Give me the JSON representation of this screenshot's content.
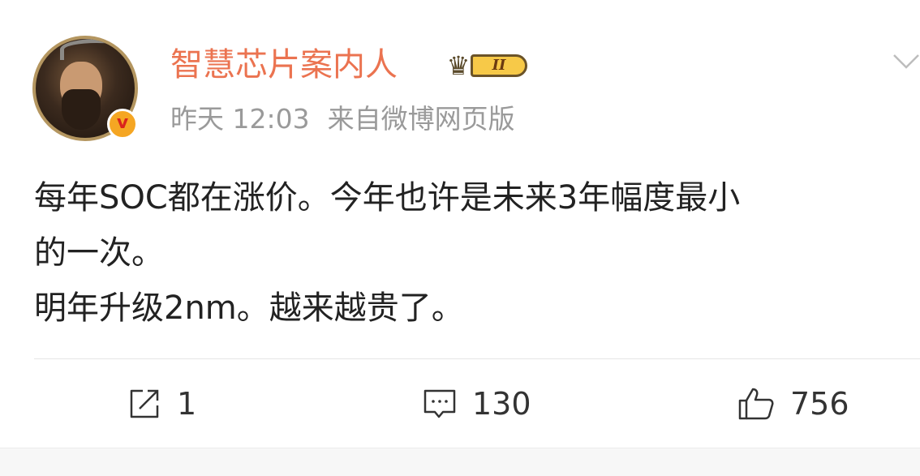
{
  "post": {
    "author": {
      "name": "智慧芯片案内人",
      "verified_badge": "v",
      "vip_level": "II",
      "avatar_icon": "portrait-avatar"
    },
    "meta": {
      "time": "昨天 12:03",
      "source": "来自微博网页版"
    },
    "content": {
      "lines": [
        "每年SOC都在涨价。今年也许是未来3年幅度最小",
        "的一次。",
        "明年升级2nm。越来越贵了。"
      ]
    },
    "actions": {
      "repost": {
        "icon": "repost-icon",
        "count": "1"
      },
      "comment": {
        "icon": "comment-icon",
        "count": "130"
      },
      "like": {
        "icon": "like-icon",
        "count": "756"
      }
    },
    "colors": {
      "username": "#eb7350",
      "meta": "#9a9a9a",
      "text": "#222222",
      "badge_orange": "#f5a623",
      "badge_red": "#d9241c"
    }
  }
}
